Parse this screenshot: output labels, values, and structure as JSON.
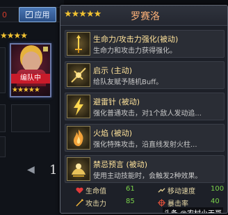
{
  "left_panel": {
    "currency_value": "0",
    "apply_button_label": "应用",
    "apply_checkmark": "✓",
    "stars_row": "★★★★",
    "team_badge": "编队中",
    "card_stars": "★★★★★",
    "prev_arrow": "◀",
    "page_number": "1"
  },
  "tooltip": {
    "stars": "★★★★★",
    "name": "罗赛洛",
    "skills": [
      {
        "icon": "sword-up-icon",
        "title": "生命力/攻击力强化(被动)",
        "desc": "生命力和攻击力获得强化。"
      },
      {
        "icon": "revelation-icon",
        "title": "启示 (主动)",
        "desc": "给队友赋予随机Buff。"
      },
      {
        "icon": "lightning-rod-icon",
        "title": "避雷针 (被动)",
        "desc": "强化普通攻击，对1个敌人发动追..."
      },
      {
        "icon": "flame-icon",
        "title": "火焰 (被动)",
        "desc": "强化特殊攻击，沿直线发射火柱..."
      },
      {
        "icon": "forbidden-prophecy-icon",
        "title": "禁忌预言 (被动)",
        "desc": "使用主动技能时，会触发2种效果。"
      }
    ],
    "stats": [
      {
        "icon": "heart-icon",
        "label": "生命值",
        "value": "61"
      },
      {
        "icon": "attack-icon",
        "label": "攻击力",
        "value": "85"
      },
      {
        "icon": "move-speed-icon",
        "label": "移动速度",
        "value": "100"
      },
      {
        "icon": "crit-rate-icon",
        "label": "暴击率",
        "value": "40"
      }
    ],
    "watermark": "头条 @农村小天哥"
  },
  "colors": {
    "star": "#f1c232",
    "name": "#ffb37a",
    "skill_title": "#ffe39b",
    "stat_value": "#7bd34a",
    "badge": "#c81b2a"
  }
}
